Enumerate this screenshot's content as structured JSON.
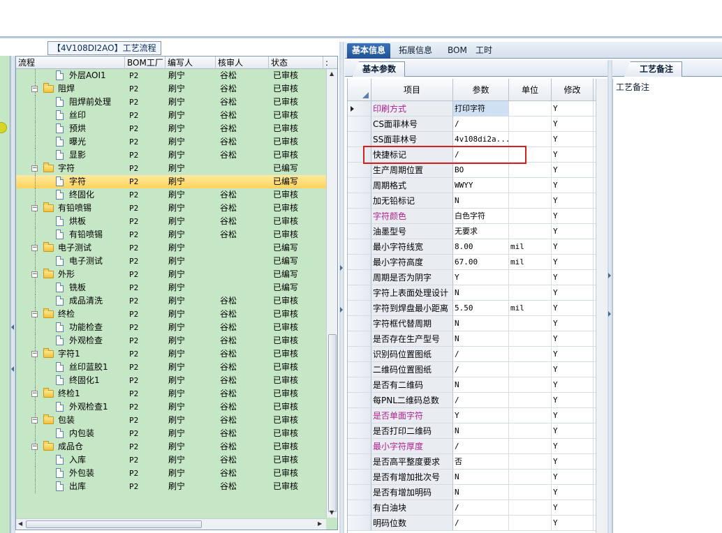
{
  "tree_panel": {
    "title": "【4V108DI2AO】工艺流程",
    "columns": [
      "流程",
      "BOM工厂",
      "编写人",
      "核审人",
      "状态"
    ],
    "rows": [
      {
        "level": 2,
        "type": "doc",
        "expander": "",
        "name": "外层AOI1",
        "bom": "P2",
        "author": "刷宁",
        "reviewer": "谷松",
        "status": "已审核"
      },
      {
        "level": 1,
        "type": "folder",
        "expander": "−",
        "name": "阻焊",
        "bom": "P2",
        "author": "刷宁",
        "reviewer": "谷松",
        "status": "已审核"
      },
      {
        "level": 2,
        "type": "doc",
        "expander": "",
        "name": "阻焊前处理",
        "bom": "P2",
        "author": "刷宁",
        "reviewer": "谷松",
        "status": "已审核"
      },
      {
        "level": 2,
        "type": "doc",
        "expander": "",
        "name": "丝印",
        "bom": "P2",
        "author": "刷宁",
        "reviewer": "谷松",
        "status": "已审核"
      },
      {
        "level": 2,
        "type": "doc",
        "expander": "",
        "name": "预烘",
        "bom": "P2",
        "author": "刷宁",
        "reviewer": "谷松",
        "status": "已审核"
      },
      {
        "level": 2,
        "type": "doc",
        "expander": "",
        "name": "曝光",
        "bom": "P2",
        "author": "刷宁",
        "reviewer": "谷松",
        "status": "已审核"
      },
      {
        "level": 2,
        "type": "doc",
        "expander": "",
        "name": "显影",
        "bom": "P2",
        "author": "刷宁",
        "reviewer": "谷松",
        "status": "已审核"
      },
      {
        "level": 1,
        "type": "folder",
        "expander": "−",
        "name": "字符",
        "bom": "P2",
        "author": "刷宁",
        "reviewer": "",
        "status": "已编写"
      },
      {
        "level": 2,
        "type": "doc",
        "expander": "",
        "name": "字符",
        "bom": "P2",
        "author": "刷宁",
        "reviewer": "",
        "status": "已编写",
        "selected": true
      },
      {
        "level": 2,
        "type": "doc",
        "expander": "",
        "name": "终固化",
        "bom": "P2",
        "author": "刷宁",
        "reviewer": "谷松",
        "status": "已审核"
      },
      {
        "level": 1,
        "type": "folder",
        "expander": "−",
        "name": "有铅喷锡",
        "bom": "P2",
        "author": "刷宁",
        "reviewer": "谷松",
        "status": "已审核"
      },
      {
        "level": 2,
        "type": "doc",
        "expander": "",
        "name": "烘板",
        "bom": "P2",
        "author": "刷宁",
        "reviewer": "谷松",
        "status": "已审核"
      },
      {
        "level": 2,
        "type": "doc",
        "expander": "",
        "name": "有铅喷锡",
        "bom": "P2",
        "author": "刷宁",
        "reviewer": "谷松",
        "status": "已审核"
      },
      {
        "level": 1,
        "type": "folder",
        "expander": "−",
        "name": "电子测试",
        "bom": "P2",
        "author": "刷宁",
        "reviewer": "",
        "status": "已编写"
      },
      {
        "level": 2,
        "type": "doc",
        "expander": "",
        "name": "电子测试",
        "bom": "P2",
        "author": "刷宁",
        "reviewer": "",
        "status": "已编写"
      },
      {
        "level": 1,
        "type": "folder",
        "expander": "−",
        "name": "外形",
        "bom": "P2",
        "author": "刷宁",
        "reviewer": "",
        "status": "已编写"
      },
      {
        "level": 2,
        "type": "doc",
        "expander": "",
        "name": "铣板",
        "bom": "P2",
        "author": "刷宁",
        "reviewer": "",
        "status": "已编写"
      },
      {
        "level": 2,
        "type": "doc",
        "expander": "",
        "name": "成品清洗",
        "bom": "P2",
        "author": "刷宁",
        "reviewer": "谷松",
        "status": "已审核"
      },
      {
        "level": 1,
        "type": "folder",
        "expander": "−",
        "name": "终检",
        "bom": "P2",
        "author": "刷宁",
        "reviewer": "谷松",
        "status": "已审核"
      },
      {
        "level": 2,
        "type": "doc",
        "expander": "",
        "name": "功能检查",
        "bom": "P2",
        "author": "刷宁",
        "reviewer": "谷松",
        "status": "已审核"
      },
      {
        "level": 2,
        "type": "doc",
        "expander": "",
        "name": "外观检查",
        "bom": "P2",
        "author": "刷宁",
        "reviewer": "谷松",
        "status": "已审核"
      },
      {
        "level": 1,
        "type": "folder",
        "expander": "−",
        "name": "字符1",
        "bom": "P2",
        "author": "刷宁",
        "reviewer": "谷松",
        "status": "已审核"
      },
      {
        "level": 2,
        "type": "doc",
        "expander": "",
        "name": "丝印蓝胶1",
        "bom": "P2",
        "author": "刷宁",
        "reviewer": "谷松",
        "status": "已审核"
      },
      {
        "level": 2,
        "type": "doc",
        "expander": "",
        "name": "终固化1",
        "bom": "P2",
        "author": "刷宁",
        "reviewer": "谷松",
        "status": "已审核"
      },
      {
        "level": 1,
        "type": "folder",
        "expander": "−",
        "name": "终检1",
        "bom": "P2",
        "author": "刷宁",
        "reviewer": "谷松",
        "status": "已审核"
      },
      {
        "level": 2,
        "type": "doc",
        "expander": "",
        "name": "外观检查1",
        "bom": "P2",
        "author": "刷宁",
        "reviewer": "谷松",
        "status": "已审核"
      },
      {
        "level": 1,
        "type": "folder",
        "expander": "−",
        "name": "包装",
        "bom": "P2",
        "author": "刷宁",
        "reviewer": "谷松",
        "status": "已审核"
      },
      {
        "level": 2,
        "type": "doc",
        "expander": "",
        "name": "内包装",
        "bom": "P2",
        "author": "刷宁",
        "reviewer": "谷松",
        "status": "已审核"
      },
      {
        "level": 1,
        "type": "folder",
        "expander": "−",
        "name": "成品仓",
        "bom": "P2",
        "author": "刷宁",
        "reviewer": "谷松",
        "status": "已审核"
      },
      {
        "level": 2,
        "type": "doc",
        "expander": "",
        "name": "入库",
        "bom": "P2",
        "author": "刷宁",
        "reviewer": "谷松",
        "status": "已审核"
      },
      {
        "level": 2,
        "type": "doc",
        "expander": "",
        "name": "外包装",
        "bom": "P2",
        "author": "刷宁",
        "reviewer": "谷松",
        "status": "已审核"
      },
      {
        "level": 2,
        "type": "doc",
        "expander": "",
        "name": "出库",
        "bom": "P2",
        "author": "刷宁",
        "reviewer": "谷松",
        "status": "已审核"
      }
    ]
  },
  "tabs": [
    {
      "label": "基本信息",
      "active": true
    },
    {
      "label": "拓展信息",
      "active": false
    },
    {
      "label": "BOM",
      "active": false
    },
    {
      "label": "工时",
      "active": false
    }
  ],
  "subtab": {
    "label": "基本参数"
  },
  "notes_tab": {
    "label": "工艺备注"
  },
  "notes_label": "工艺备注",
  "grid": {
    "columns": [
      "项目",
      "参数",
      "单位",
      "修改"
    ],
    "rows": [
      {
        "item": "印刷方式",
        "param": "打印字符",
        "unit": "",
        "mod": "Y",
        "highlight": true,
        "current": true,
        "param_selected": true
      },
      {
        "item": "CS面菲林号",
        "param": "/",
        "unit": "",
        "mod": "Y"
      },
      {
        "item": "SS面菲林号",
        "param": "4v108di2a...",
        "unit": "",
        "mod": "Y"
      },
      {
        "item": "快捷标记",
        "param": "/",
        "unit": "",
        "mod": "Y"
      },
      {
        "item": "生产周期位置",
        "param": "BO",
        "unit": "",
        "mod": "Y"
      },
      {
        "item": "周期格式",
        "param": "WWYY",
        "unit": "",
        "mod": "Y"
      },
      {
        "item": "加无铅标记",
        "param": "N",
        "unit": "",
        "mod": "Y"
      },
      {
        "item": "字符颜色",
        "param": "白色字符",
        "unit": "",
        "mod": "Y",
        "highlight": true
      },
      {
        "item": "油墨型号",
        "param": "无要求",
        "unit": "",
        "mod": "Y"
      },
      {
        "item": "最小字符线宽",
        "param": "8.00",
        "unit": "mil",
        "mod": "Y"
      },
      {
        "item": "最小字符高度",
        "param": "67.00",
        "unit": "mil",
        "mod": "Y"
      },
      {
        "item": "周期是否为阴字",
        "param": "Y",
        "unit": "",
        "mod": "Y"
      },
      {
        "item": "字符上表面处理设计",
        "param": "N",
        "unit": "",
        "mod": "Y"
      },
      {
        "item": "字符到焊盘最小距离",
        "param": "5.50",
        "unit": "mil",
        "mod": "Y"
      },
      {
        "item": "字符框代替周期",
        "param": "N",
        "unit": "",
        "mod": "Y"
      },
      {
        "item": "是否存在生产型号",
        "param": "N",
        "unit": "",
        "mod": "Y"
      },
      {
        "item": "识别码位置图纸",
        "param": "/",
        "unit": "",
        "mod": "Y"
      },
      {
        "item": "二维码位置图纸",
        "param": "/",
        "unit": "",
        "mod": "Y"
      },
      {
        "item": "是否有二维码",
        "param": "N",
        "unit": "",
        "mod": "Y"
      },
      {
        "item": "每PNL二维码总数",
        "param": "/",
        "unit": "",
        "mod": "Y"
      },
      {
        "item": "是否单面字符",
        "param": "Y",
        "unit": "",
        "mod": "Y",
        "highlight": true
      },
      {
        "item": "是否打印二维码",
        "param": "N",
        "unit": "",
        "mod": "Y"
      },
      {
        "item": "最小字符厚度",
        "param": "/",
        "unit": "",
        "mod": "Y",
        "highlight": true
      },
      {
        "item": "是否高平整度要求",
        "param": "否",
        "unit": "",
        "mod": "Y"
      },
      {
        "item": "是否有增加批次号",
        "param": "N",
        "unit": "",
        "mod": "Y"
      },
      {
        "item": "是否有增加明码",
        "param": "N",
        "unit": "",
        "mod": "Y"
      },
      {
        "item": "有白油块",
        "param": "/",
        "unit": "",
        "mod": "Y"
      },
      {
        "item": "明码位数",
        "param": "/",
        "unit": "",
        "mod": "Y"
      }
    ]
  },
  "colors": {
    "tree_bg": "#c6e7c6",
    "selected_row": "#ffd25a",
    "highlight_text": "#b0208f",
    "annotation_box": "#d32020",
    "active_tab": "#1f5296"
  }
}
